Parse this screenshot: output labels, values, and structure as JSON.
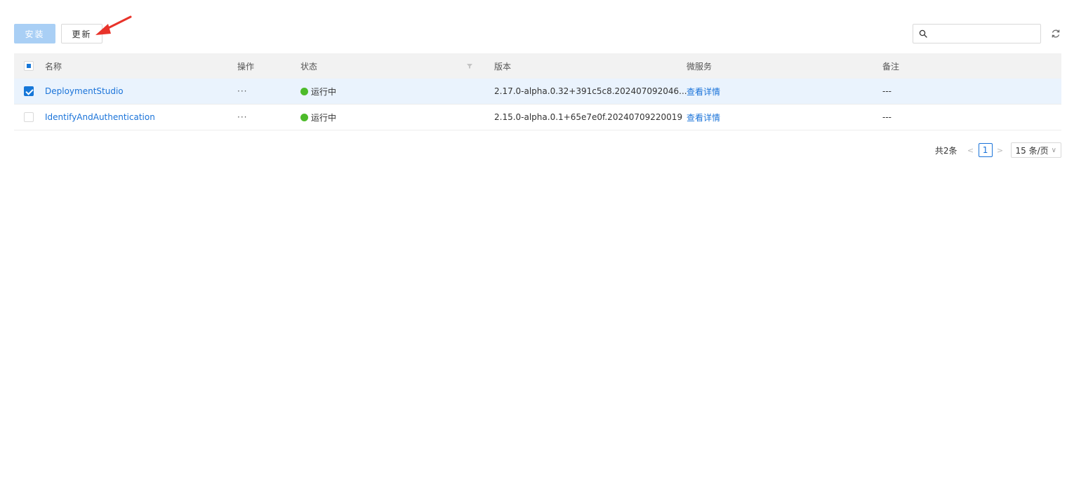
{
  "toolbar": {
    "install_label": "安装",
    "update_label": "更新",
    "search_placeholder": "",
    "search_value": ""
  },
  "table": {
    "columns": {
      "name": "名称",
      "operation": "操作",
      "status": "状态",
      "version": "版本",
      "microservice": "微服务",
      "note": "备注"
    },
    "rows": [
      {
        "name": "DeploymentStudio",
        "operation": "···",
        "status": "运行中",
        "version": "2.17.0-alpha.0.32+391c5c8.202407092046...",
        "microservice": "查看详情",
        "note": "---",
        "selected": true
      },
      {
        "name": "IdentifyAndAuthentication",
        "operation": "···",
        "status": "运行中",
        "version": "2.15.0-alpha.0.1+65e7e0f.20240709220019",
        "microservice": "查看详情",
        "note": "---",
        "selected": false
      }
    ]
  },
  "pagination": {
    "total": "共2条",
    "current_page": "1",
    "page_size": "15 条/页",
    "prev": "<",
    "next": ">"
  },
  "colors": {
    "accent": "#1a73d9",
    "install_disabled": "#a9cff5",
    "status_running": "#4dbb2a",
    "arrow": "#e8332a",
    "selected_row": "#eaf3fd",
    "header_bg": "#f2f2f2"
  },
  "icons": [
    "search-icon",
    "refresh-icon",
    "filter-icon",
    "annotation-arrow",
    "chevron-down-icon"
  ]
}
